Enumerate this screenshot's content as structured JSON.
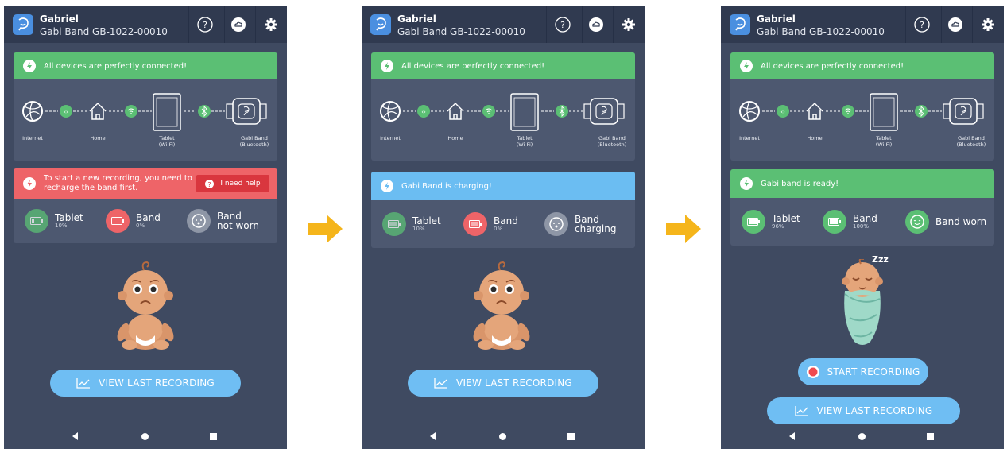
{
  "screens": [
    {
      "header": {
        "user_name": "Gabriel",
        "device_name": "Gabi Band GB-1022-00010"
      },
      "connection_banner": "All devices are perfectly connected!",
      "nodes": {
        "internet": "Internet",
        "home": "Home",
        "tablet": "Tablet",
        "tablet_sub": "(Wi-Fi)",
        "band": "Gabi Band",
        "band_sub": "(Bluetooth)"
      },
      "status_banner": {
        "text_line1": "To start a new recording, you need to",
        "text_line2": "recharge the band first.",
        "button": "I need help",
        "color": "#ee6468"
      },
      "stats": {
        "tablet": {
          "title": "Tablet",
          "sub": "10%"
        },
        "band": {
          "title": "Band",
          "sub": "0%"
        },
        "worn": {
          "title": "Band",
          "title2": "not worn"
        }
      },
      "view_button": "VIEW LAST RECORDING"
    },
    {
      "header": {
        "user_name": "Gabriel",
        "device_name": "Gabi Band GB-1022-00010"
      },
      "connection_banner": "All devices are perfectly connected!",
      "nodes": {
        "internet": "Internet",
        "home": "Home",
        "tablet": "Tablet",
        "tablet_sub": "(Wi-Fi)",
        "band": "Gabi Band",
        "band_sub": "(Bluetooth)"
      },
      "status_banner": {
        "text": "Gabi Band is charging!",
        "color": "#6bbdf2"
      },
      "stats": {
        "tablet": {
          "title": "Tablet",
          "sub": "10%"
        },
        "band": {
          "title": "Band",
          "sub": "0%"
        },
        "worn": {
          "title": "Band",
          "title2": "charging"
        }
      },
      "view_button": "VIEW LAST RECORDING"
    },
    {
      "header": {
        "user_name": "Gabriel",
        "device_name": "Gabi Band GB-1022-00010"
      },
      "connection_banner": "All devices are perfectly connected!",
      "nodes": {
        "internet": "Internet",
        "home": "Home",
        "tablet": "Tablet",
        "tablet_sub": "(Wi-Fi)",
        "band": "Gabi Band",
        "band_sub": "(Bluetooth)"
      },
      "status_banner": {
        "text": "Gabi band is ready!",
        "color": "#5bbf74"
      },
      "stats": {
        "tablet": {
          "title": "Tablet",
          "sub": "96%"
        },
        "band": {
          "title": "Band",
          "sub": "100%"
        },
        "worn": {
          "title": "Band worn"
        }
      },
      "sleep_text": "Zzz",
      "start_button": "START RECORDING",
      "view_button": "VIEW LAST RECORDING"
    }
  ],
  "colors": {
    "phone_bg": "#3f4a61",
    "topbar": "#303a50",
    "card": "#4d5870",
    "green": "#5bbf74",
    "red": "#ee6468",
    "blue": "#6bbdf2",
    "arrow": "#f5b51b"
  },
  "icons": [
    "help-icon",
    "cloud-icon",
    "gear-icon",
    "internet-globe-icon",
    "home-icon",
    "tablet-icon",
    "band-icon",
    "wifi-icon",
    "bluetooth-icon",
    "battery-icon",
    "baby-face-icon",
    "chart-icon",
    "record-dot-icon"
  ]
}
